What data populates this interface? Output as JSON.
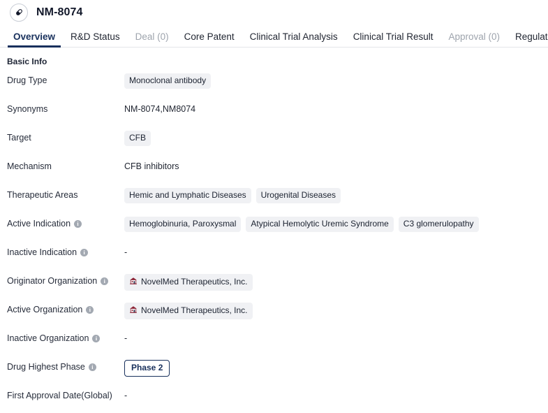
{
  "header": {
    "title": "NM-8074",
    "avatar_icon": "capsule-pill-icon"
  },
  "tabs": [
    {
      "label": "Overview",
      "state": "active"
    },
    {
      "label": "R&D Status",
      "state": "normal"
    },
    {
      "label": "Deal (0)",
      "state": "disabled"
    },
    {
      "label": "Core Patent",
      "state": "normal"
    },
    {
      "label": "Clinical Trial Analysis",
      "state": "normal"
    },
    {
      "label": "Clinical Trial Result",
      "state": "normal"
    },
    {
      "label": "Approval (0)",
      "state": "disabled"
    },
    {
      "label": "Regulation",
      "state": "normal"
    }
  ],
  "section": {
    "title": "Basic Info"
  },
  "rows": [
    {
      "label": "Drug Type",
      "has_info": false,
      "type": "chips",
      "values": [
        "Monoclonal antibody"
      ]
    },
    {
      "label": "Synonyms",
      "has_info": false,
      "type": "text",
      "text": "NM-8074,NM8074"
    },
    {
      "label": "Target",
      "has_info": false,
      "type": "chips",
      "values": [
        "CFB"
      ]
    },
    {
      "label": "Mechanism",
      "has_info": false,
      "type": "text",
      "text": "CFB inhibitors"
    },
    {
      "label": "Therapeutic Areas",
      "has_info": false,
      "type": "chips",
      "values": [
        "Hemic and Lymphatic Diseases",
        "Urogenital Diseases"
      ]
    },
    {
      "label": "Active Indication",
      "has_info": true,
      "type": "chips",
      "values": [
        "Hemoglobinuria, Paroxysmal",
        "Atypical Hemolytic Uremic Syndrome",
        "C3 glomerulopathy"
      ]
    },
    {
      "label": "Inactive Indication",
      "has_info": true,
      "type": "text",
      "text": "-"
    },
    {
      "label": "Originator Organization",
      "has_info": true,
      "type": "org-chips",
      "values": [
        "NovelMed Therapeutics, Inc."
      ]
    },
    {
      "label": "Active Organization",
      "has_info": true,
      "type": "org-chips",
      "values": [
        "NovelMed Therapeutics, Inc."
      ]
    },
    {
      "label": "Inactive Organization",
      "has_info": true,
      "type": "text",
      "text": "-"
    },
    {
      "label": "Drug Highest Phase",
      "has_info": true,
      "type": "phase",
      "values": [
        "Phase 2"
      ]
    },
    {
      "label": "First Approval Date(Global)",
      "has_info": false,
      "type": "text",
      "text": "-"
    }
  ],
  "icons": {
    "info": "info-circle-icon",
    "org": "company-building-icon"
  },
  "colors": {
    "accent": "#18305c",
    "chip_bg": "#f0f1f4",
    "text": "#1f2430",
    "muted": "#9ea4ad",
    "border": "#e3e5e9",
    "org_icon": "#8c2436"
  }
}
